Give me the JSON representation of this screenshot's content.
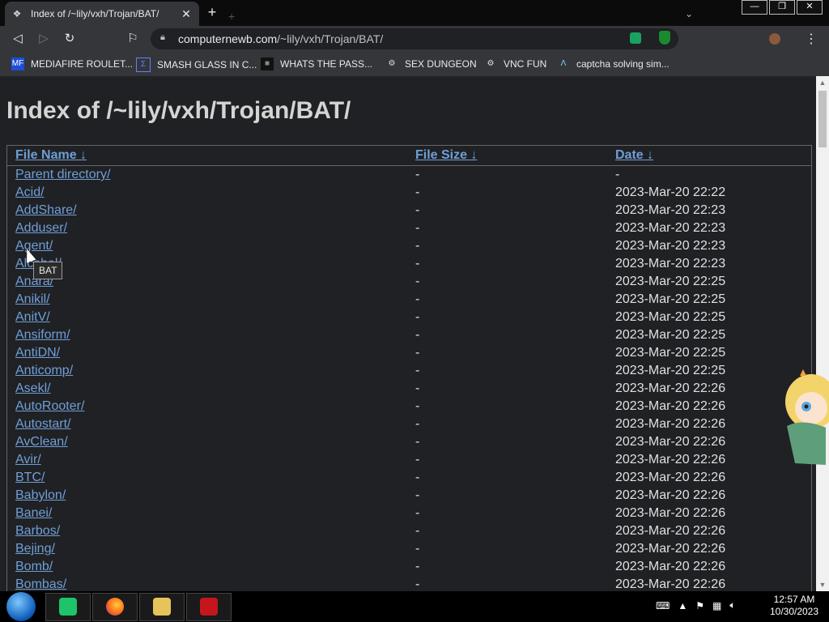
{
  "browser": {
    "tab_title": "Index of /~lily/vxh/Trojan/BAT/",
    "new_tab": "+",
    "url_host": "computernewb.com",
    "url_path": "/~lily/vxh/Trojan/BAT/",
    "window_controls": [
      "—",
      "❐",
      "✕"
    ]
  },
  "bookmarks": [
    {
      "label": "MEDIAFIRE ROULET...",
      "icon": "MF"
    },
    {
      "label": "SMASH GLASS IN C...",
      "icon": "Σ"
    },
    {
      "label": "WHATS THE PASS...",
      "icon": "■"
    },
    {
      "label": "SEX DUNGEON",
      "icon": "⚙"
    },
    {
      "label": "VNC FUN",
      "icon": "⚙"
    },
    {
      "label": "captcha solving sim...",
      "icon": "Λ"
    }
  ],
  "page": {
    "heading": "Index of /~lily/vxh/Trojan/BAT/",
    "columns": {
      "name": "File Name ↓",
      "size": "File Size ↓",
      "date": "Date ↓"
    },
    "rows": [
      {
        "name": "Parent directory/",
        "size": "-",
        "date": "-"
      },
      {
        "name": "Acid/",
        "size": "-",
        "date": "2023-Mar-20 22:22"
      },
      {
        "name": "AddShare/",
        "size": "-",
        "date": "2023-Mar-20 22:23"
      },
      {
        "name": "Adduser/",
        "size": "-",
        "date": "2023-Mar-20 22:23"
      },
      {
        "name": "Agent/",
        "size": "-",
        "date": "2023-Mar-20 22:23"
      },
      {
        "name": "Alcohol/",
        "size": "-",
        "date": "2023-Mar-20 22:23"
      },
      {
        "name": "Anara/",
        "size": "-",
        "date": "2023-Mar-20 22:25"
      },
      {
        "name": "Anikil/",
        "size": "-",
        "date": "2023-Mar-20 22:25"
      },
      {
        "name": "AnitV/",
        "size": "-",
        "date": "2023-Mar-20 22:25"
      },
      {
        "name": "Ansiform/",
        "size": "-",
        "date": "2023-Mar-20 22:25"
      },
      {
        "name": "AntiDN/",
        "size": "-",
        "date": "2023-Mar-20 22:25"
      },
      {
        "name": "Anticomp/",
        "size": "-",
        "date": "2023-Mar-20 22:25"
      },
      {
        "name": "Asekl/",
        "size": "-",
        "date": "2023-Mar-20 22:26"
      },
      {
        "name": "AutoRooter/",
        "size": "-",
        "date": "2023-Mar-20 22:26"
      },
      {
        "name": "Autostart/",
        "size": "-",
        "date": "2023-Mar-20 22:26"
      },
      {
        "name": "AvClean/",
        "size": "-",
        "date": "2023-Mar-20 22:26"
      },
      {
        "name": "Avir/",
        "size": "-",
        "date": "2023-Mar-20 22:26"
      },
      {
        "name": "BTC/",
        "size": "-",
        "date": "2023-Mar-20 22:26"
      },
      {
        "name": "Babylon/",
        "size": "-",
        "date": "2023-Mar-20 22:26"
      },
      {
        "name": "Banei/",
        "size": "-",
        "date": "2023-Mar-20 22:26"
      },
      {
        "name": "Barbos/",
        "size": "-",
        "date": "2023-Mar-20 22:26"
      },
      {
        "name": "Bejing/",
        "size": "-",
        "date": "2023-Mar-20 22:26"
      },
      {
        "name": "Bomb/",
        "size": "-",
        "date": "2023-Mar-20 22:26"
      },
      {
        "name": "Bombas/",
        "size": "-",
        "date": "2023-Mar-20 22:26"
      }
    ],
    "tooltip": "BAT"
  },
  "taskbar": {
    "time": "12:57 AM",
    "date": "10/30/2023"
  },
  "colors": {
    "link": "#6f9fd8",
    "background": "#202124",
    "toolbar": "#35363a"
  }
}
